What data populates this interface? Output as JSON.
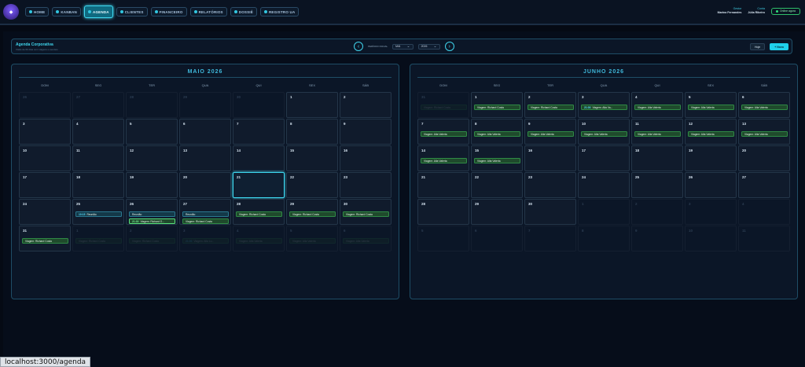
{
  "topbar": {
    "nav": [
      {
        "label": "HOME",
        "active": false
      },
      {
        "label": "KANBAN",
        "active": false
      },
      {
        "label": "AGENDA",
        "active": true
      },
      {
        "label": "CLIENTES",
        "active": false
      },
      {
        "label": "FINANCEIRO",
        "active": false
      },
      {
        "label": "RELATÓRIOS",
        "active": false
      },
      {
        "label": "DOSSIÊ",
        "active": false
      },
      {
        "label": "REGISTRO UA",
        "active": false
      }
    ],
    "user1_label": "Gestor",
    "user1_name": "Marina Fernandes",
    "user2_label": "Conta",
    "user2_name": "Júlia Ribeiro",
    "online_label": "Online agora"
  },
  "header": {
    "title": "Agenda Corporativa",
    "subtitle": "Visão de 60 dias com viagens e eventos",
    "prev_icon": "chevron-left-icon",
    "next_icon": "chevron-right-icon",
    "period_label": "PERÍODO INICIAL",
    "month_select": "MAI",
    "year_select": "2026",
    "today_btn": "Hoje",
    "new_btn": "+ Novo"
  },
  "weekdays": [
    "DOM",
    "SEG",
    "TER",
    "QUA",
    "QUI",
    "SEX",
    "SÁB"
  ],
  "months": [
    {
      "title": "MAIO 2026",
      "cells": [
        {
          "d": "26",
          "o": true
        },
        {
          "d": "27",
          "o": true
        },
        {
          "d": "28",
          "o": true
        },
        {
          "d": "29",
          "o": true
        },
        {
          "d": "30",
          "o": true
        },
        {
          "d": "1"
        },
        {
          "d": "2"
        },
        {
          "d": "3"
        },
        {
          "d": "4"
        },
        {
          "d": "5"
        },
        {
          "d": "6"
        },
        {
          "d": "7"
        },
        {
          "d": "8"
        },
        {
          "d": "9"
        },
        {
          "d": "10"
        },
        {
          "d": "11"
        },
        {
          "d": "12"
        },
        {
          "d": "13"
        },
        {
          "d": "14"
        },
        {
          "d": "15"
        },
        {
          "d": "16"
        },
        {
          "d": "17"
        },
        {
          "d": "18"
        },
        {
          "d": "19"
        },
        {
          "d": "20"
        },
        {
          "d": "21",
          "today": true
        },
        {
          "d": "22"
        },
        {
          "d": "23"
        },
        {
          "d": "24"
        },
        {
          "d": "25",
          "ev": [
            {
              "c": "teal",
              "t": "10:15",
              "x": "Reunião"
            }
          ]
        },
        {
          "d": "26",
          "ev": [
            {
              "c": "teal",
              "x": "Reunião"
            },
            {
              "c": "greenlt",
              "t": "21:30",
              "x": "Viagem: Richard O..."
            }
          ]
        },
        {
          "d": "27",
          "ev": [
            {
              "c": "teal",
              "x": "Reunião"
            },
            {
              "c": "green",
              "x": "Viagem: Richard Costa"
            }
          ]
        },
        {
          "d": "28",
          "ev": [
            {
              "c": "green",
              "x": "Viagem: Richard Costa"
            }
          ]
        },
        {
          "d": "29",
          "ev": [
            {
              "c": "green",
              "x": "Viagem: Richard Costa"
            }
          ]
        },
        {
          "d": "30",
          "ev": [
            {
              "c": "green",
              "x": "Viagem: Richard Costa"
            }
          ]
        },
        {
          "d": "31",
          "ev": [
            {
              "c": "green",
              "x": "Viagem: Richard Costa"
            }
          ]
        },
        {
          "d": "1",
          "o": true,
          "ev": [
            {
              "c": "green",
              "x": "Viagem: Richard Costa"
            }
          ]
        },
        {
          "d": "2",
          "o": true,
          "ev": [
            {
              "c": "green",
              "x": "Viagem: Richard Costa"
            }
          ]
        },
        {
          "d": "3",
          "o": true,
          "ev": [
            {
              "c": "green",
              "t": "21:00",
              "x": "Viagem: Alta Lu..."
            }
          ]
        },
        {
          "d": "4",
          "o": true,
          "ev": [
            {
              "c": "green",
              "x": "Viagem: Alta Valerta"
            }
          ]
        },
        {
          "d": "5",
          "o": true,
          "ev": [
            {
              "c": "green",
              "x": "Viagem: Alta Valerta"
            }
          ]
        },
        {
          "d": "6",
          "o": true,
          "ev": [
            {
              "c": "green",
              "x": "Viagem: Alta Valerta"
            }
          ]
        }
      ]
    },
    {
      "title": "JUNHO 2026",
      "cells": [
        {
          "d": "31",
          "o": true,
          "ev": [
            {
              "c": "green",
              "x": "Viagem: Richard Costa"
            }
          ]
        },
        {
          "d": "1",
          "ev": [
            {
              "c": "green",
              "x": "Viagem: Richard Costa"
            }
          ]
        },
        {
          "d": "2",
          "ev": [
            {
              "c": "green",
              "x": "Viagem: Richard Costa"
            }
          ]
        },
        {
          "d": "3",
          "ev": [
            {
              "c": "green",
              "t": "21:00",
              "x": "Viagem: Alta Va..."
            }
          ]
        },
        {
          "d": "4",
          "ev": [
            {
              "c": "green",
              "x": "Viagem: Alta Valerta"
            }
          ]
        },
        {
          "d": "5",
          "ev": [
            {
              "c": "green",
              "x": "Viagem: Alta Valerta"
            }
          ]
        },
        {
          "d": "6",
          "ev": [
            {
              "c": "green",
              "x": "Viagem: Alta Valerta"
            }
          ]
        },
        {
          "d": "7",
          "ev": [
            {
              "c": "green",
              "x": "Viagem: Alta Valerta"
            }
          ]
        },
        {
          "d": "8",
          "ev": [
            {
              "c": "green",
              "x": "Viagem: Alta Valerta"
            }
          ]
        },
        {
          "d": "9",
          "ev": [
            {
              "c": "green",
              "x": "Viagem: Alta Valerta"
            }
          ]
        },
        {
          "d": "10",
          "ev": [
            {
              "c": "green",
              "x": "Viagem: Alta Valerta"
            }
          ]
        },
        {
          "d": "11",
          "ev": [
            {
              "c": "green",
              "x": "Viagem: Alta Valerta"
            }
          ]
        },
        {
          "d": "12",
          "ev": [
            {
              "c": "green",
              "x": "Viagem: Alta Valerta"
            }
          ]
        },
        {
          "d": "13",
          "ev": [
            {
              "c": "green",
              "x": "Viagem: Alta Valerta"
            }
          ]
        },
        {
          "d": "14",
          "ev": [
            {
              "c": "green",
              "x": "Viagem: Alta Valerta"
            }
          ]
        },
        {
          "d": "15",
          "ev": [
            {
              "c": "green",
              "x": "Viagem: Alta Valerta"
            }
          ]
        },
        {
          "d": "16"
        },
        {
          "d": "17"
        },
        {
          "d": "18"
        },
        {
          "d": "19"
        },
        {
          "d": "20"
        },
        {
          "d": "21"
        },
        {
          "d": "22"
        },
        {
          "d": "23"
        },
        {
          "d": "24"
        },
        {
          "d": "25"
        },
        {
          "d": "26"
        },
        {
          "d": "27"
        },
        {
          "d": "28"
        },
        {
          "d": "29"
        },
        {
          "d": "30"
        },
        {
          "d": "1",
          "o": true
        },
        {
          "d": "2",
          "o": true
        },
        {
          "d": "3",
          "o": true
        },
        {
          "d": "4",
          "o": true
        },
        {
          "d": "5",
          "o": true
        },
        {
          "d": "6",
          "o": true
        },
        {
          "d": "7",
          "o": true
        },
        {
          "d": "8",
          "o": true
        },
        {
          "d": "9",
          "o": true
        },
        {
          "d": "10",
          "o": true
        },
        {
          "d": "11",
          "o": true
        }
      ]
    }
  ],
  "status_url": "localhost:3000/agenda"
}
